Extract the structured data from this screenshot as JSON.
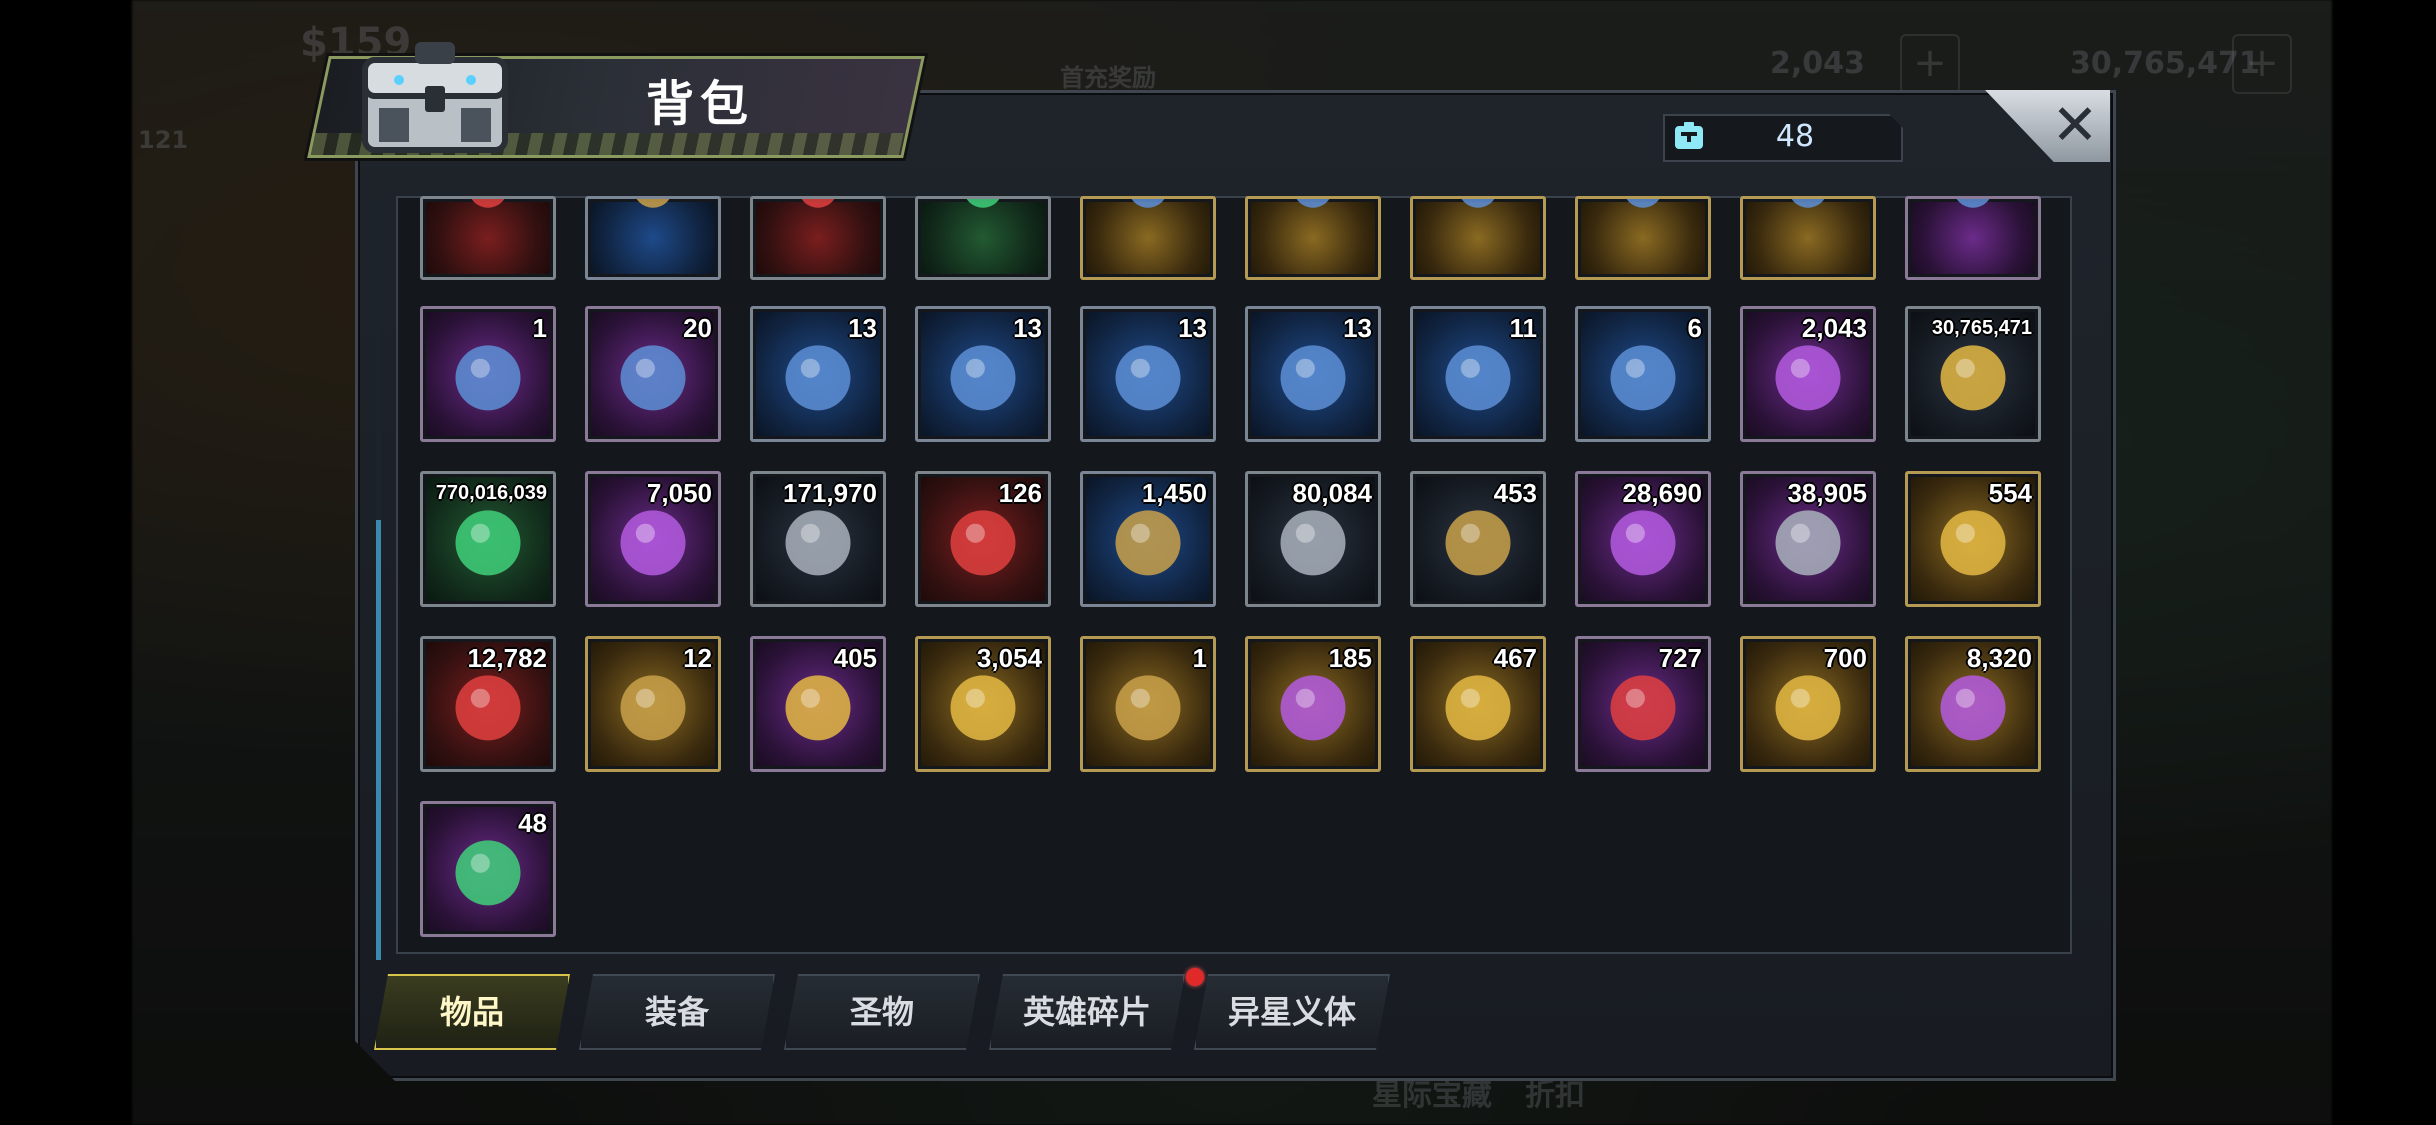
{
  "background": {
    "top_left_cash": "$159",
    "promo_label": "首充奖励",
    "top_left_level": "121",
    "resource_1": "2,043",
    "resource_2": "30,765,471",
    "bottom_text_1": "星际宝藏",
    "bottom_text_2": "折扣"
  },
  "window": {
    "title": "背包",
    "capacity_count": "48",
    "close_icon": "close-icon"
  },
  "items": [
    {
      "icon": "poker-chip-icon",
      "qty": "",
      "rarity": "r-red"
    },
    {
      "icon": "syringe-icon",
      "qty": "",
      "rarity": "r-blue"
    },
    {
      "icon": "ornament-ball-icon",
      "qty": "",
      "rarity": "r-red"
    },
    {
      "icon": "emerald-ring-icon",
      "qty": "",
      "rarity": "r-green"
    },
    {
      "icon": "glasses-blueprint-icon",
      "qty": "",
      "rarity": "r-gold"
    },
    {
      "icon": "swords-blueprint-icon",
      "qty": "",
      "rarity": "r-gold"
    },
    {
      "icon": "hat-blueprint-icon",
      "qty": "",
      "rarity": "r-gold"
    },
    {
      "icon": "shirt-blueprint-icon",
      "qty": "",
      "rarity": "r-gold"
    },
    {
      "icon": "boot-blueprint-icon",
      "qty": "",
      "rarity": "r-gold"
    },
    {
      "icon": "hat-blueprint-icon",
      "qty": "",
      "rarity": "r-purple"
    },
    {
      "icon": "glasses-blueprint-icon",
      "qty": "1",
      "rarity": "r-purple"
    },
    {
      "icon": "shirt-blueprint-icon",
      "qty": "20",
      "rarity": "r-purple"
    },
    {
      "icon": "swords-blueprint-icon",
      "qty": "13",
      "rarity": "r-blue"
    },
    {
      "icon": "hat-blueprint-icon",
      "qty": "13",
      "rarity": "r-blue"
    },
    {
      "icon": "shirt-blueprint-icon",
      "qty": "13",
      "rarity": "r-blue"
    },
    {
      "icon": "revolver-blueprint-icon",
      "qty": "13",
      "rarity": "r-blue"
    },
    {
      "icon": "boot-blueprint-icon",
      "qty": "11",
      "rarity": "r-blue"
    },
    {
      "icon": "glasses-blueprint-icon",
      "qty": "6",
      "rarity": "r-blue"
    },
    {
      "icon": "purple-gem-icon",
      "qty": "2,043",
      "rarity": "r-purple"
    },
    {
      "icon": "gold-coins-icon",
      "qty": "30,765,471",
      "rarity": "r-dark",
      "small": true
    },
    {
      "icon": "green-canister-icon",
      "qty": "770,016,039",
      "rarity": "r-green",
      "small": true
    },
    {
      "icon": "purple-core-icon",
      "qty": "7,050",
      "rarity": "r-purple"
    },
    {
      "icon": "gear-icon",
      "qty": "171,970",
      "rarity": "r-dark"
    },
    {
      "icon": "red-network-icon",
      "qty": "126",
      "rarity": "r-red"
    },
    {
      "icon": "eye-badge-icon",
      "qty": "1,450",
      "rarity": "r-blue"
    },
    {
      "icon": "silver-emblem-icon",
      "qty": "80,084",
      "rarity": "r-dark"
    },
    {
      "icon": "fist-badge-icon",
      "qty": "453",
      "rarity": "r-dark"
    },
    {
      "icon": "puzzle-piece-icon",
      "qty": "28,690",
      "rarity": "r-purple"
    },
    {
      "icon": "ship-gear-icon",
      "qty": "38,905",
      "rarity": "r-purple"
    },
    {
      "icon": "gold-ship-gear-icon",
      "qty": "554",
      "rarity": "r-gold"
    },
    {
      "icon": "red-target-icon",
      "qty": "12,782",
      "rarity": "r-red"
    },
    {
      "icon": "star-play-icon",
      "qty": "12",
      "rarity": "r-gold"
    },
    {
      "icon": "lightning-coin-icon",
      "qty": "405",
      "rarity": "r-purple"
    },
    {
      "icon": "golden-fist-icon",
      "qty": "3,054",
      "rarity": "r-gold"
    },
    {
      "icon": "propeller-icon",
      "qty": "1",
      "rarity": "r-gold"
    },
    {
      "icon": "pink-crystal-icon",
      "qty": "185",
      "rarity": "r-gold"
    },
    {
      "icon": "gold-coin-stack-icon",
      "qty": "467",
      "rarity": "r-gold"
    },
    {
      "icon": "red-hex-icon",
      "qty": "727",
      "rarity": "r-purple"
    },
    {
      "icon": "golden-potion-icon",
      "qty": "700",
      "rarity": "r-gold"
    },
    {
      "icon": "crystal-orb-icon",
      "qty": "8,320",
      "rarity": "r-gold"
    },
    {
      "icon": "dna-icon",
      "qty": "48",
      "rarity": "r-purple"
    }
  ],
  "tabs": [
    {
      "label": "物品",
      "active": true
    },
    {
      "label": "装备",
      "active": false
    },
    {
      "label": "圣物",
      "active": false
    },
    {
      "label": "英雄碎片",
      "active": false,
      "badge": true
    },
    {
      "label": "异星义体",
      "active": false
    }
  ],
  "colors": {
    "active_tab_border": "#d8c44a",
    "badge_red": "#e02a2a",
    "rarity_purple": "#6b2b8a",
    "rarity_blue": "#1e4a8a",
    "rarity_gold": "#8a6a22"
  }
}
